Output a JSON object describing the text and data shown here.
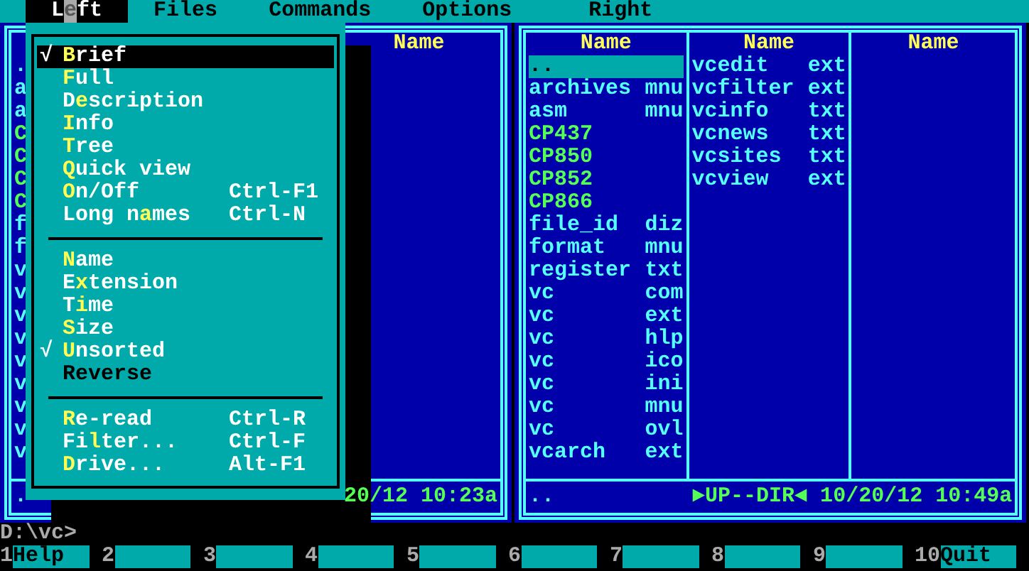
{
  "menu_bar": [
    {
      "label": "L**e**ft",
      "selected": true
    },
    {
      "label": "Files",
      "selected": false
    },
    {
      "label": "Commands",
      "selected": false
    },
    {
      "label": "Options",
      "selected": false
    },
    {
      "label": "Right",
      "selected": false
    }
  ],
  "left_panel": {
    "column_3_header": "Name",
    "visible_initials": [
      {
        "text": ".",
        "color": "#55ffff"
      },
      {
        "text": "a",
        "color": "#55ffff"
      },
      {
        "text": "a",
        "color": "#55ffff"
      },
      {
        "text": "C",
        "color": "#55ff55"
      },
      {
        "text": "C",
        "color": "#55ff55"
      },
      {
        "text": "C",
        "color": "#55ff55"
      },
      {
        "text": "C",
        "color": "#55ff55"
      },
      {
        "text": "f",
        "color": "#55ffff"
      },
      {
        "text": "f",
        "color": "#55ffff"
      },
      {
        "text": "v",
        "color": "#55ffff"
      },
      {
        "text": "v",
        "color": "#55ffff"
      },
      {
        "text": "v",
        "color": "#55ffff"
      },
      {
        "text": "v",
        "color": "#55ffff"
      },
      {
        "text": "v",
        "color": "#55ffff"
      },
      {
        "text": "v",
        "color": "#55ffff"
      },
      {
        "text": "v",
        "color": "#55ffff"
      },
      {
        "text": "v",
        "color": "#55ffff"
      },
      {
        "text": "v",
        "color": "#55ffff"
      }
    ],
    "footer_name": ".",
    "footer_info": "20/12 10:23a"
  },
  "right_panel": {
    "columns": [
      {
        "header": "Name",
        "files": [
          {
            "name": "..",
            "selected": true
          },
          {
            "name": "archives",
            "ext": "mnu",
            "selected": false,
            "color": "#55ffff"
          },
          {
            "name": "asm",
            "ext": "mnu",
            "selected": false,
            "color": "#55ffff"
          },
          {
            "name": "CP437",
            "selected": false,
            "color": "#55ff55"
          },
          {
            "name": "CP850",
            "selected": false,
            "color": "#55ff55"
          },
          {
            "name": "CP852",
            "selected": false,
            "color": "#55ff55"
          },
          {
            "name": "CP866",
            "selected": false,
            "color": "#55ff55"
          },
          {
            "name": "file_id",
            "ext": "diz",
            "selected": false,
            "color": "#55ffff"
          },
          {
            "name": "format",
            "ext": "mnu",
            "selected": false,
            "color": "#55ffff"
          },
          {
            "name": "register",
            "ext": "txt",
            "selected": false,
            "color": "#55ffff"
          },
          {
            "name": "vc",
            "ext": "com",
            "selected": false,
            "color": "#55ffff"
          },
          {
            "name": "vc",
            "ext": "ext",
            "selected": false,
            "color": "#55ffff"
          },
          {
            "name": "vc",
            "ext": "hlp",
            "selected": false,
            "color": "#55ffff"
          },
          {
            "name": "vc",
            "ext": "ico",
            "selected": false,
            "color": "#55ffff"
          },
          {
            "name": "vc",
            "ext": "ini",
            "selected": false,
            "color": "#55ffff"
          },
          {
            "name": "vc",
            "ext": "mnu",
            "selected": false,
            "color": "#55ffff"
          },
          {
            "name": "vc",
            "ext": "ovl",
            "selected": false,
            "color": "#55ffff"
          },
          {
            "name": "vcarch",
            "ext": "ext",
            "selected": false,
            "color": "#55ffff"
          }
        ]
      },
      {
        "header": "Name",
        "files": [
          {
            "name": "vcedit",
            "ext": "ext",
            "selected": false,
            "color": "#55ffff"
          },
          {
            "name": "vcfilter",
            "ext": "ext",
            "selected": false,
            "color": "#55ffff"
          },
          {
            "name": "vcinfo",
            "ext": "txt",
            "selected": false,
            "color": "#55ffff"
          },
          {
            "name": "vcnews",
            "ext": "txt",
            "selected": false,
            "color": "#55ffff"
          },
          {
            "name": "vcsites",
            "ext": "txt",
            "selected": false,
            "color": "#55ffff"
          },
          {
            "name": "vcview",
            "ext": "ext",
            "selected": false,
            "color": "#55ffff"
          }
        ]
      },
      {
        "header": "Name"
      }
    ],
    "footer_name": "..",
    "footer_info": "►UP--DIR◄ 10/20/12 10:49a"
  },
  "dropdown": {
    "items": [
      {
        "kind": "option",
        "label": "**B**rief",
        "checked": true,
        "selected": true,
        "disabled": false
      },
      {
        "kind": "option",
        "label": "**F**ull",
        "checked": false,
        "selected": false,
        "disabled": false
      },
      {
        "kind": "option",
        "label": "D**e**scription",
        "checked": false,
        "selected": false,
        "disabled": false
      },
      {
        "kind": "option",
        "label": "**I**nfo",
        "checked": false,
        "selected": false,
        "disabled": false
      },
      {
        "kind": "option",
        "label": "**T**ree",
        "checked": false,
        "selected": false,
        "disabled": false
      },
      {
        "kind": "option",
        "label": "**Q**uick view",
        "checked": false,
        "selected": false,
        "disabled": false
      },
      {
        "kind": "option",
        "label": "**O**n/Off",
        "shortcut": "Ctrl-F1",
        "checked": false,
        "selected": false,
        "disabled": false
      },
      {
        "kind": "option",
        "label": "Long n**a**mes",
        "shortcut": "Ctrl-N",
        "checked": false,
        "selected": false,
        "disabled": false
      },
      {
        "kind": "separator"
      },
      {
        "kind": "option",
        "label": "**N**ame",
        "checked": false,
        "selected": false,
        "disabled": false
      },
      {
        "kind": "option",
        "label": "E**x**tension",
        "checked": false,
        "selected": false,
        "disabled": false
      },
      {
        "kind": "option",
        "label": "T**i**me",
        "checked": false,
        "selected": false,
        "disabled": false
      },
      {
        "kind": "option",
        "label": "**S**ize",
        "checked": false,
        "selected": false,
        "disabled": false
      },
      {
        "kind": "option",
        "label": "**U**nsorted",
        "checked": true,
        "selected": false,
        "disabled": false
      },
      {
        "kind": "option",
        "label": "Reverse",
        "checked": false,
        "selected": false,
        "disabled": true
      },
      {
        "kind": "separator"
      },
      {
        "kind": "option",
        "label": "**R**e-read",
        "shortcut": "Ctrl-R",
        "checked": false,
        "selected": false,
        "disabled": false
      },
      {
        "kind": "option",
        "label": "Fi**l**ter...",
        "shortcut": "Ctrl-F",
        "checked": false,
        "selected": false,
        "disabled": false
      },
      {
        "kind": "option",
        "label": "**D**rive...",
        "shortcut": "Alt-F1",
        "checked": false,
        "selected": false,
        "disabled": false
      }
    ],
    "check_mark": "√"
  },
  "command_line": "D:\\vc>",
  "function_keys": [
    {
      "number": "1",
      "label": "Help"
    },
    {
      "number": "2"
    },
    {
      "number": "3"
    },
    {
      "number": "4"
    },
    {
      "number": "5"
    },
    {
      "number": "6"
    },
    {
      "number": "7"
    },
    {
      "number": "8"
    },
    {
      "number": "9"
    },
    {
      "number": "10",
      "label": "Quit"
    }
  ]
}
